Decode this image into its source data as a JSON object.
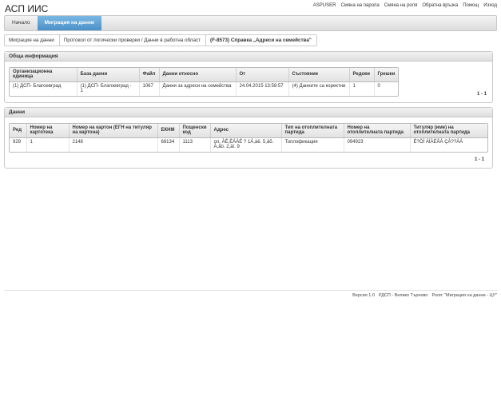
{
  "app": {
    "title": "АСП ИИС"
  },
  "top_links": [
    "ASPUSER",
    "Смяна на парола",
    "Смяна на роля",
    "Обратна връзка",
    "Помощ",
    "Изход"
  ],
  "nav": {
    "tabs": [
      {
        "label": "Начало",
        "active": false
      },
      {
        "label": "Миграция на данни",
        "active": true
      }
    ]
  },
  "breadcrumb": [
    "Миграция на данни",
    "Протокол от логически проверки / Данни в работна област",
    "(F-8573) Справка „Адреси на семейства\""
  ],
  "general_info": {
    "title": "Обща информация",
    "columns": [
      "Организационна единица",
      "База данни",
      "Файл",
      "Данни относно",
      "От",
      "Състояние",
      "Редове",
      "Грешки"
    ],
    "rows": [
      [
        "(1) ДСП- Благоевград",
        "(1) ДСП- Благоевград - 1",
        "1067",
        "Данни за адреси на семейства",
        "24.04.2015 13:58:57",
        "(4) Данните са коректни",
        "1",
        "0"
      ]
    ],
    "pager": "1 - 1"
  },
  "data_section": {
    "title": "Данни",
    "columns": [
      "Ред",
      "Номер на картотека",
      "Номер на картон (ЕГН на титуляр на картона)",
      "ЕКНМ",
      "Пощенски код",
      "Адрес",
      "Тип на отоплителната партида",
      "Номер на отоплителната партида",
      "Титуляр (име) на отоплителната партида"
    ],
    "rows": [
      [
        "929",
        "1",
        "2148",
        "68134",
        "1113",
        "ол. ÀÉ,ÈÀÀÉ ? 1À,àë. 5,âõ. À,åò. 2,àï. 9",
        "Топлофикация",
        "094923",
        "Ё?ÖÍ ÀÍÀÉÅÀ ÇÀ??ÀÀ"
      ]
    ],
    "pager": "1 - 1"
  },
  "footer": [
    "Версия 1.0",
    "РДСП - Велико Търново",
    "Роля: \"Миграция на данни - ЦУ\""
  ]
}
